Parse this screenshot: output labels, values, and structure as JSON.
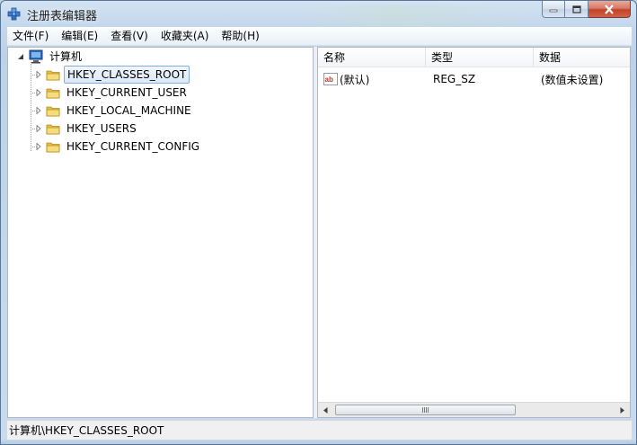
{
  "window": {
    "title": "注册表编辑器"
  },
  "menu": {
    "items": [
      {
        "label": "文件(F)"
      },
      {
        "label": "编辑(E)"
      },
      {
        "label": "查看(V)"
      },
      {
        "label": "收藏夹(A)"
      },
      {
        "label": "帮助(H)"
      }
    ]
  },
  "tree": {
    "root_label": "计算机",
    "items": [
      {
        "label": "HKEY_CLASSES_ROOT",
        "selected": true
      },
      {
        "label": "HKEY_CURRENT_USER"
      },
      {
        "label": "HKEY_LOCAL_MACHINE"
      },
      {
        "label": "HKEY_USERS"
      },
      {
        "label": "HKEY_CURRENT_CONFIG"
      }
    ]
  },
  "list": {
    "columns": [
      "名称",
      "类型",
      "数据"
    ],
    "rows": [
      {
        "name": "(默认)",
        "type": "REG_SZ",
        "data": "(数值未设置)",
        "icon": "string-value-icon"
      }
    ]
  },
  "status": {
    "path": "计算机\\HKEY_CLASSES_ROOT"
  },
  "colors": {
    "accent": "#84acdd",
    "close_button": "#c4432a"
  }
}
